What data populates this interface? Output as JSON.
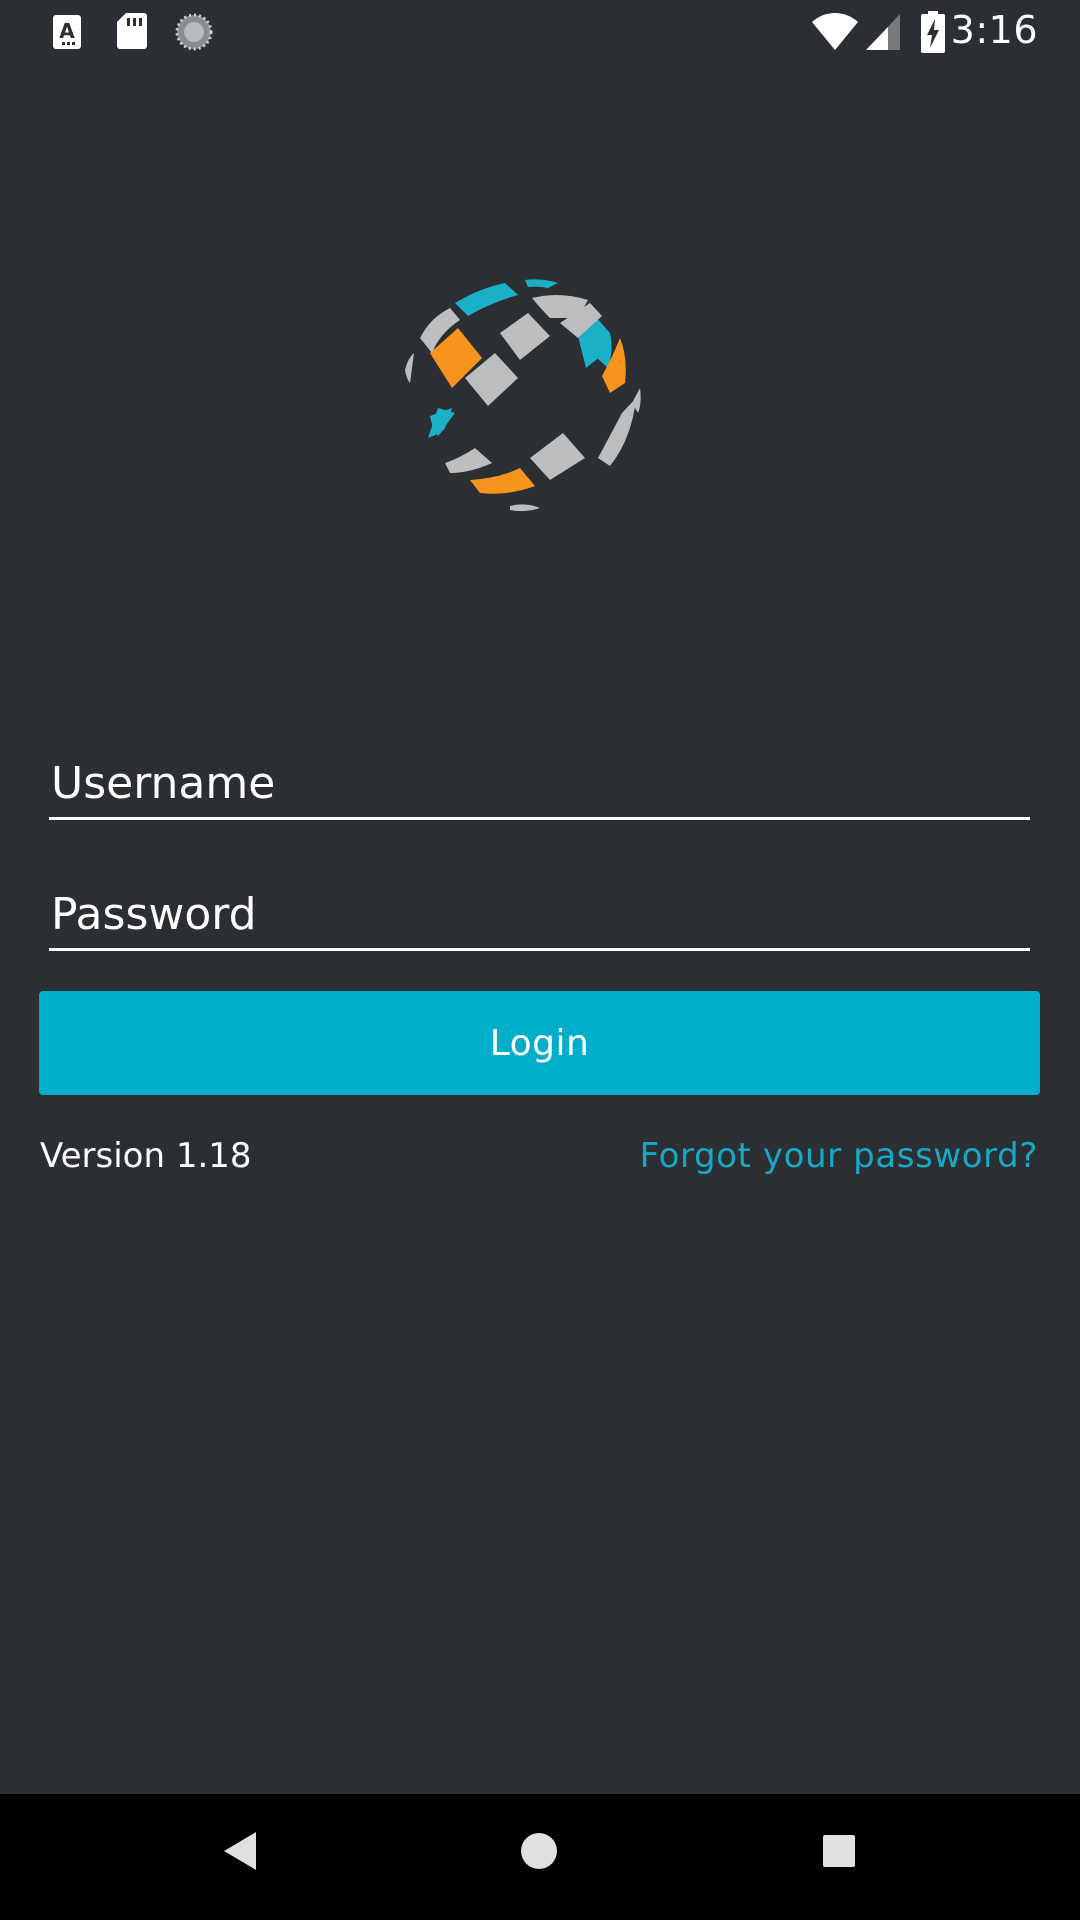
{
  "status_bar": {
    "time": "3:16",
    "left_icons": [
      "text-notification-icon",
      "sd-card-icon",
      "loading-spinner-icon"
    ],
    "right_icons": [
      "wifi-icon",
      "cell-signal-icon",
      "battery-charging-icon"
    ]
  },
  "logo": {
    "icon": "globe-logo-icon",
    "colors": {
      "teal": "#1ab0c8",
      "orange": "#f7941d",
      "gray": "#bcbec0"
    }
  },
  "form": {
    "username_placeholder": "Username",
    "username_value": "",
    "password_placeholder": "Password",
    "password_value": "",
    "login_label": "Login"
  },
  "footer": {
    "version": "Version 1.18",
    "forgot_password": "Forgot your password?"
  },
  "nav_bar": {
    "buttons": [
      "back-icon",
      "home-icon",
      "recents-icon"
    ]
  },
  "colors": {
    "background": "#2b2e32",
    "accent": "#00aec9",
    "link": "#16a9c6"
  }
}
